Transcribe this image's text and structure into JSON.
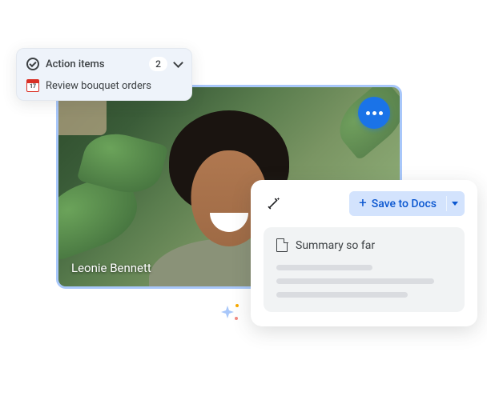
{
  "video": {
    "participant_name": "Leonie Bennett"
  },
  "action_panel": {
    "title": "Action items",
    "count": "2",
    "items": [
      "Review bouquet orders"
    ]
  },
  "summary": {
    "save_label": "Save to Docs",
    "title": "Summary so far"
  }
}
